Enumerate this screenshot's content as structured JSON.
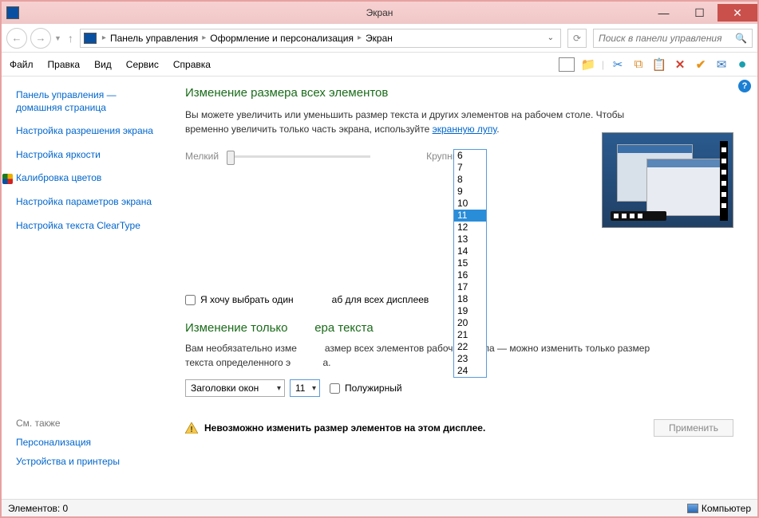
{
  "window": {
    "title": "Экран"
  },
  "breadcrumb": {
    "items": [
      "Панель управления",
      "Оформление и персонализация",
      "Экран"
    ]
  },
  "search": {
    "placeholder": "Поиск в панели управления"
  },
  "menubar": {
    "items": [
      "Файл",
      "Правка",
      "Вид",
      "Сервис",
      "Справка"
    ]
  },
  "sidebar": {
    "items": [
      "Панель управления — домашняя страница",
      "Настройка разрешения экрана",
      "Настройка яркости",
      "Калибровка цветов",
      "Настройка параметров экрана",
      "Настройка текста ClearType"
    ]
  },
  "see_also": {
    "header": "См. также",
    "items": [
      "Персонализация",
      "Устройства и принтеры"
    ]
  },
  "main": {
    "h1": "Изменение размера всех элементов",
    "desc_pre": "Вы можете увеличить или уменьшить размер текста и других элементов на рабочем столе. Чтобы временно увеличить только часть экрана, используйте ",
    "desc_link": "экранную лупу",
    "slider_min": "Мелкий",
    "slider_max": "Крупный",
    "checkbox_pre": "Я хочу выбрать один",
    "checkbox_post": "аб для всех дисплеев",
    "h2_pre": "Изменение только",
    "h2_post": "ера текста",
    "desc2_pre": "Вам необязательно изме",
    "desc2_mid": "азмер всех элементов рабочего стола — можно изменить только размер текста определенного э",
    "desc2_post": "а.",
    "combo1": "Заголовки окон",
    "combo2": "11",
    "bold_label": "Полужирный",
    "warning": "Невозможно изменить размер элементов на этом дисплее.",
    "apply": "Применить"
  },
  "dropdown_options": [
    "6",
    "7",
    "8",
    "9",
    "10",
    "11",
    "12",
    "13",
    "14",
    "15",
    "16",
    "17",
    "18",
    "19",
    "20",
    "21",
    "22",
    "23",
    "24"
  ],
  "dropdown_selected": "11",
  "statusbar": {
    "left": "Элементов: 0",
    "right": "Компьютер"
  }
}
